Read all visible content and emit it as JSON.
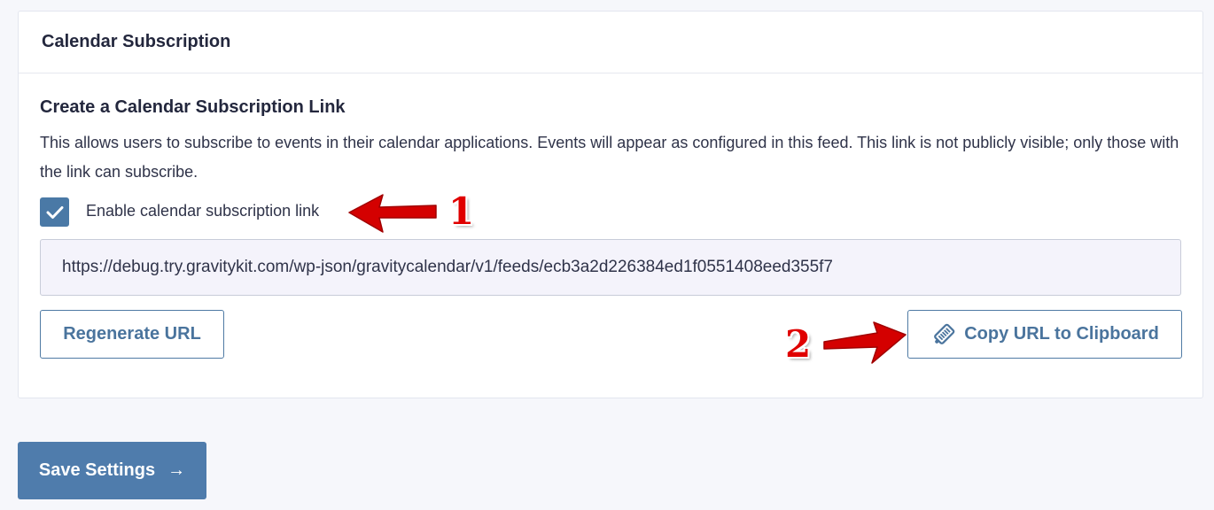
{
  "card": {
    "title": "Calendar Subscription",
    "section_title": "Create a Calendar Subscription Link",
    "description": "This allows users to subscribe to events in their calendar applications. Events will appear as configured in this feed. This link is not publicly visible; only those with the link can subscribe.",
    "checkbox": {
      "label": "Enable calendar subscription link",
      "checked": true
    },
    "url_value": "https://debug.try.gravitykit.com/wp-json/gravitycalendar/v1/feeds/ecb3a2d226384ed1f0551408eed355f7",
    "regenerate_label": "Regenerate URL",
    "copy_label": "Copy URL to Clipboard",
    "copy_icon": "clipboard-tag-icon"
  },
  "save": {
    "label": "Save Settings",
    "arrow": "→"
  },
  "annotations": {
    "one": "1",
    "two": "2",
    "color": "#e00000"
  },
  "colors": {
    "accent": "#4f7cac",
    "background": "#f6f7fb"
  }
}
